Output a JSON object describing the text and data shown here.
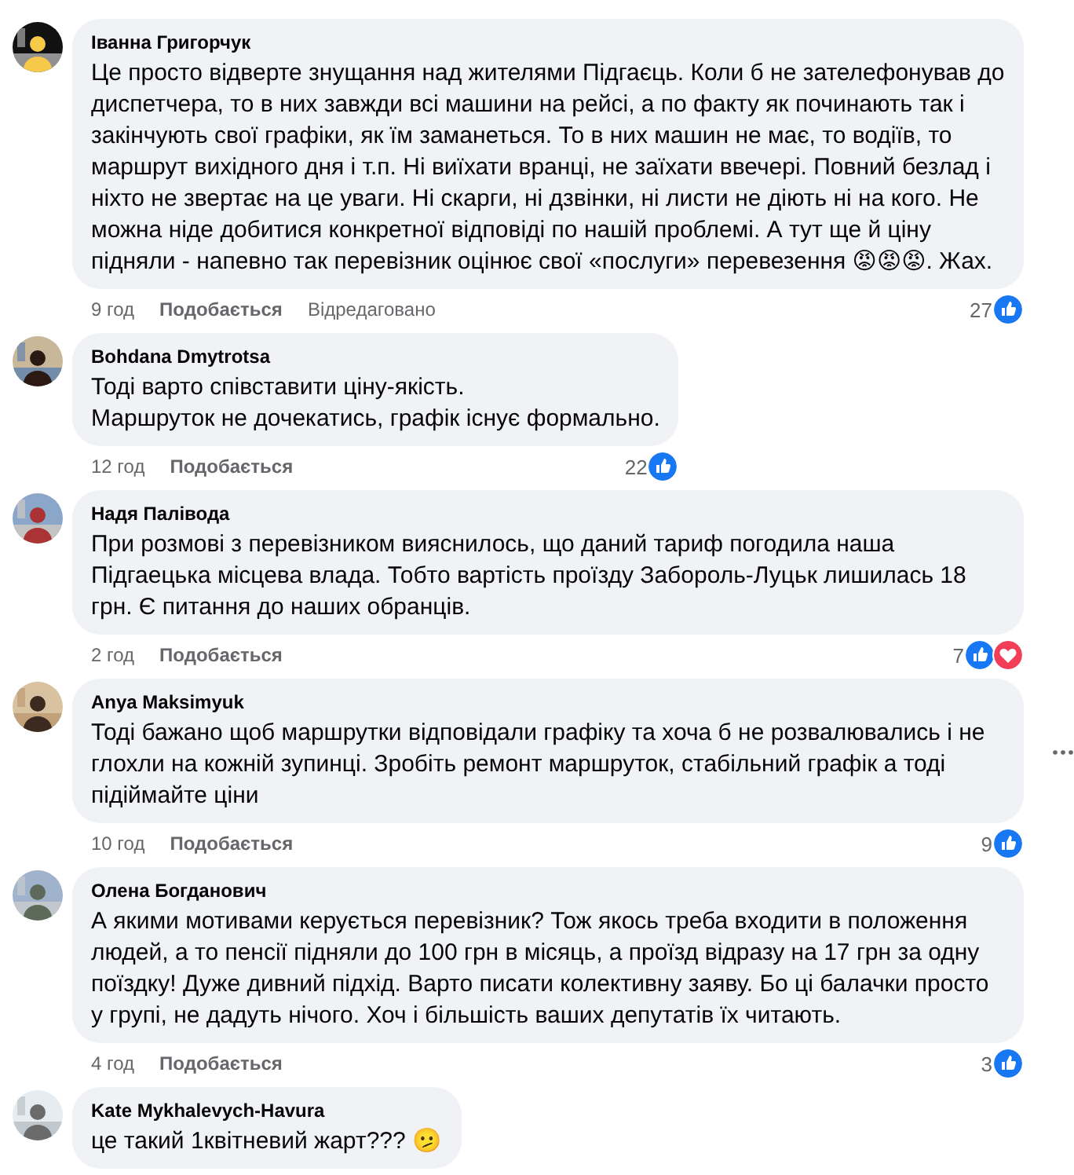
{
  "comments": [
    {
      "author": "Іванна Григорчук",
      "text": "Це просто відверте знущання над жителями Підгаєць. Коли б не зателефонував до диспетчера, то в них завжди всі машини на рейсі, а по факту як починають так і закінчують свої графіки, як їм заманеться. То в них машин не має, то водіїв, то маршрут вихідного дня і т.п. Ні виїхати вранці, не заїхати ввечері. Повний безлад і ніхто не звертає на це уваги. Ні скарги, ні дзвінки, ні листи не діють ні на кого. Не можна ніде добитися конкретної відповіді по нашій проблемі. А тут ще й ціну підняли - напевно так перевізник оцінює свої «послуги» перевезення 😡😡😡. Жах.",
      "time": "9 год",
      "like_label": "Подобається",
      "edited": "Відредаговано",
      "reaction_count": "27",
      "reactions": [
        {
          "kind": "like"
        }
      ]
    },
    {
      "author": "Bohdana Dmytrotsa",
      "text": "Тоді варто співставити ціну-якість.\nМаршруток не дочекатись, графік існує формально.",
      "time": "12 год",
      "like_label": "Подобається",
      "reaction_count": "22",
      "reactions": [
        {
          "kind": "like"
        }
      ]
    },
    {
      "author": "Надя Палівода",
      "text": "При розмові з перевізником вияснилось, що даний тариф погодила наша Підгаецька місцева влада. Тобто вартість проїзду Забороль-Луцьк лишилась 18 грн. Є питання до наших обранців.",
      "time": "2 год",
      "like_label": "Подобається",
      "reaction_count": "7",
      "reactions": [
        {
          "kind": "like"
        },
        {
          "kind": "love"
        }
      ]
    },
    {
      "author": "Anya Maksimyuk",
      "text": "Тоді бажано щоб маршрутки відповідали графіку та хоча б не розвалювались і не глохли на кожній зупинці. Зробіть ремонт маршруток, стабільний графік а тоді підіймайте ціни",
      "time": "10 год",
      "like_label": "Подобається",
      "reaction_count": "9",
      "reactions": [
        {
          "kind": "like"
        }
      ],
      "more_menu": true
    },
    {
      "author": "Олена Богданович",
      "text": "А якими мотивами керується перевізник? Тож якось треба входити в положення людей, а то пенсії підняли до 100 грн в місяць, а проїзд відразу на 17 грн за одну поїздку! Дуже дивний підхід. Варто писати колективну заяву. Бо ці балачки просто у групі, не дадуть нічого. Хоч і більшість ваших депутатів їх читають.",
      "time": "4 год",
      "like_label": "Подобається",
      "reaction_count": "3",
      "reactions": [
        {
          "kind": "like"
        }
      ]
    },
    {
      "author": "Kate Mykhalevych-Havura",
      "text": "це такий 1квітневий жарт??? 🫤"
    }
  ]
}
